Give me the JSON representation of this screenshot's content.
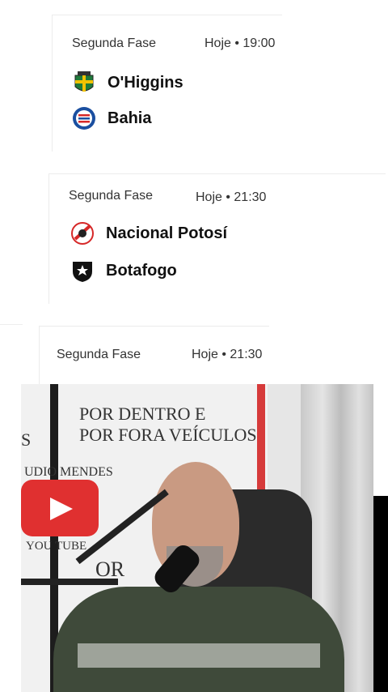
{
  "matches": [
    {
      "stage": "Segunda Fase",
      "time": "Hoje • 19:00",
      "home": {
        "name": "O'Higgins",
        "crest_color": "#1f7a3a"
      },
      "away": {
        "name": "Bahia",
        "crest_color": "#1b4fa0"
      }
    },
    {
      "stage": "Segunda Fase",
      "time": "Hoje • 21:30",
      "home": {
        "name": "Nacional Potosí",
        "crest_color": "#d62828"
      },
      "away": {
        "name": "Botafogo",
        "crest_color": "#111111"
      }
    },
    {
      "stage": "Segunda Fase",
      "time": "Hoje • 21:30"
    }
  ],
  "video": {
    "banner_line1": "POR DENTRO E",
    "banner_line2": "POR FORA VEÍCULOS",
    "banner_left_letter": "S",
    "banner_studio": "UDIO MENDES",
    "banner_youtube": "YOU TUBE",
    "banner_partial": "OR",
    "accent_color": "#d63a3a"
  }
}
